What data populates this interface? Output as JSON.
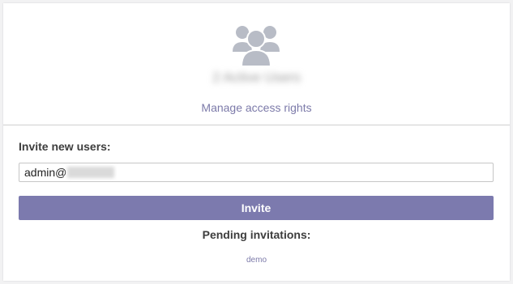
{
  "header": {
    "icon": "users-group-icon",
    "users_count_text": "2 Active Users",
    "manage_link": "Manage access rights"
  },
  "invite": {
    "label": "Invite new users:",
    "email_value": "admin@",
    "button_label": "Invite"
  },
  "pending": {
    "label": "Pending invitations:",
    "items": [
      "demo"
    ]
  },
  "colors": {
    "accent": "#7c7aae",
    "icon_gray": "#b8bcc6",
    "link": "#7c7aa9"
  }
}
